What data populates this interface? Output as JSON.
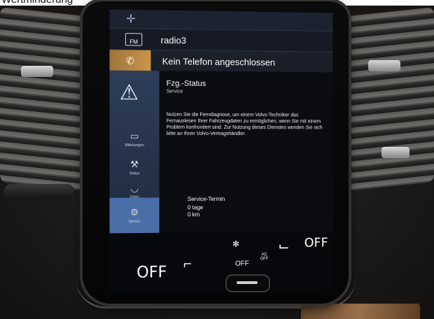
{
  "caption": "Wertminderung",
  "screen": {
    "nav_icon": "navigation-compass-icon",
    "radio": {
      "band": "FM",
      "station": "radio3"
    },
    "phone": {
      "status": "Kein Telefon angeschlossen"
    },
    "app": {
      "title": "Fzg.-Status",
      "subtitle": "Service",
      "body": "Nutzen Sie die Ferndiagnose, um einem Volvo-Techniker das Fernauslesen Ihrer Fahrzeugdaten zu ermöglichen, wenn Sie mit einem Problem konfrontiert sind. Zur Nutzung dieses Dienstes wenden Sie sich bitte an Ihren Volvo-Vertragshändler.",
      "service_title": "Service-Termin",
      "service_days": "0 tage",
      "service_km": "0 km"
    },
    "sidebar": [
      {
        "label": "Mitteilungen",
        "icon": "message-icon"
      },
      {
        "label": "Status",
        "icon": "wrench-icon"
      },
      {
        "label": "TPMS",
        "icon": "tire-pressure-icon"
      },
      {
        "label": "Service",
        "icon": "service-icon"
      }
    ],
    "climate": {
      "left_off": "OFF",
      "right_off": "OFF",
      "fan_off": "OFF",
      "ac_label": "AC",
      "ac_off": "OFF"
    }
  },
  "colors": {
    "accent_phone": "#c9954d",
    "sidebar_active": "#4a6fa8"
  }
}
